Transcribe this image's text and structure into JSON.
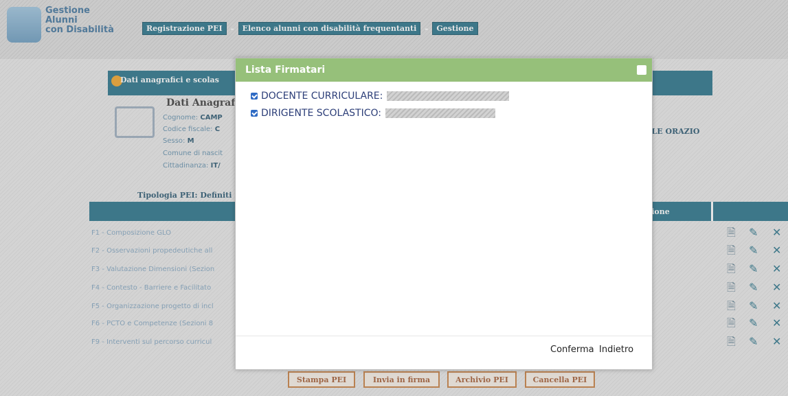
{
  "header": {
    "app_title_line1": "Gestione",
    "app_title_line2": "Alunni",
    "app_title_line3": "con Disabilità",
    "breadcrumb": [
      "Registrazione PEI",
      "Elenco alunni con disabilità frequentanti",
      "Gestione"
    ],
    "breadcrumb_separator": "-"
  },
  "background": {
    "section_title": "Dati anagrafici e scolas",
    "anagrafica_title": "Dati Anagrafi",
    "fields": [
      {
        "label": "Cognome:",
        "value": "CAMP"
      },
      {
        "label": "Codice fiscale:",
        "value": "C"
      },
      {
        "label": "Sesso:",
        "value": "M"
      },
      {
        "label": "Comune di nascit",
        "value": ""
      },
      {
        "label": "Cittadinanza:",
        "value": "IT/"
      }
    ],
    "right_name": "ALE ORAZIO",
    "tipologia": "Tipologia PEI: Definiti",
    "table_header_label": "zione",
    "rows": [
      "F1 - Composizione GLO",
      "F2 - Osservazioni propedeutiche all",
      "F3 - Valutazione Dimensioni (Sezion",
      "F4 - Contesto - Barriere e Facilitato",
      "F5 - Organizzazione progetto di incl",
      "F6 - PCTO e Competenze (Sezioni 8",
      "F9 - Interventi sul percorso curricul"
    ],
    "bottom_buttons": [
      "Stampa PEI",
      "Invia in firma",
      "Archivio PEI",
      "Cancella PEI"
    ]
  },
  "modal": {
    "title": "Lista Firmatari",
    "signatories": [
      {
        "role": "DOCENTE CURRICULARE:",
        "checked": true
      },
      {
        "role": "DIRIGENTE SCOLASTICO:",
        "checked": true
      }
    ],
    "confirm_label": "Conferma",
    "back_label": "Indietro"
  },
  "colors": {
    "accent": "#1f6d84",
    "modal_header": "#96c07a",
    "button_border": "#c47a3a"
  },
  "icons": {
    "row_actions": [
      "document-icon",
      "edit-icon",
      "delete-icon"
    ]
  }
}
